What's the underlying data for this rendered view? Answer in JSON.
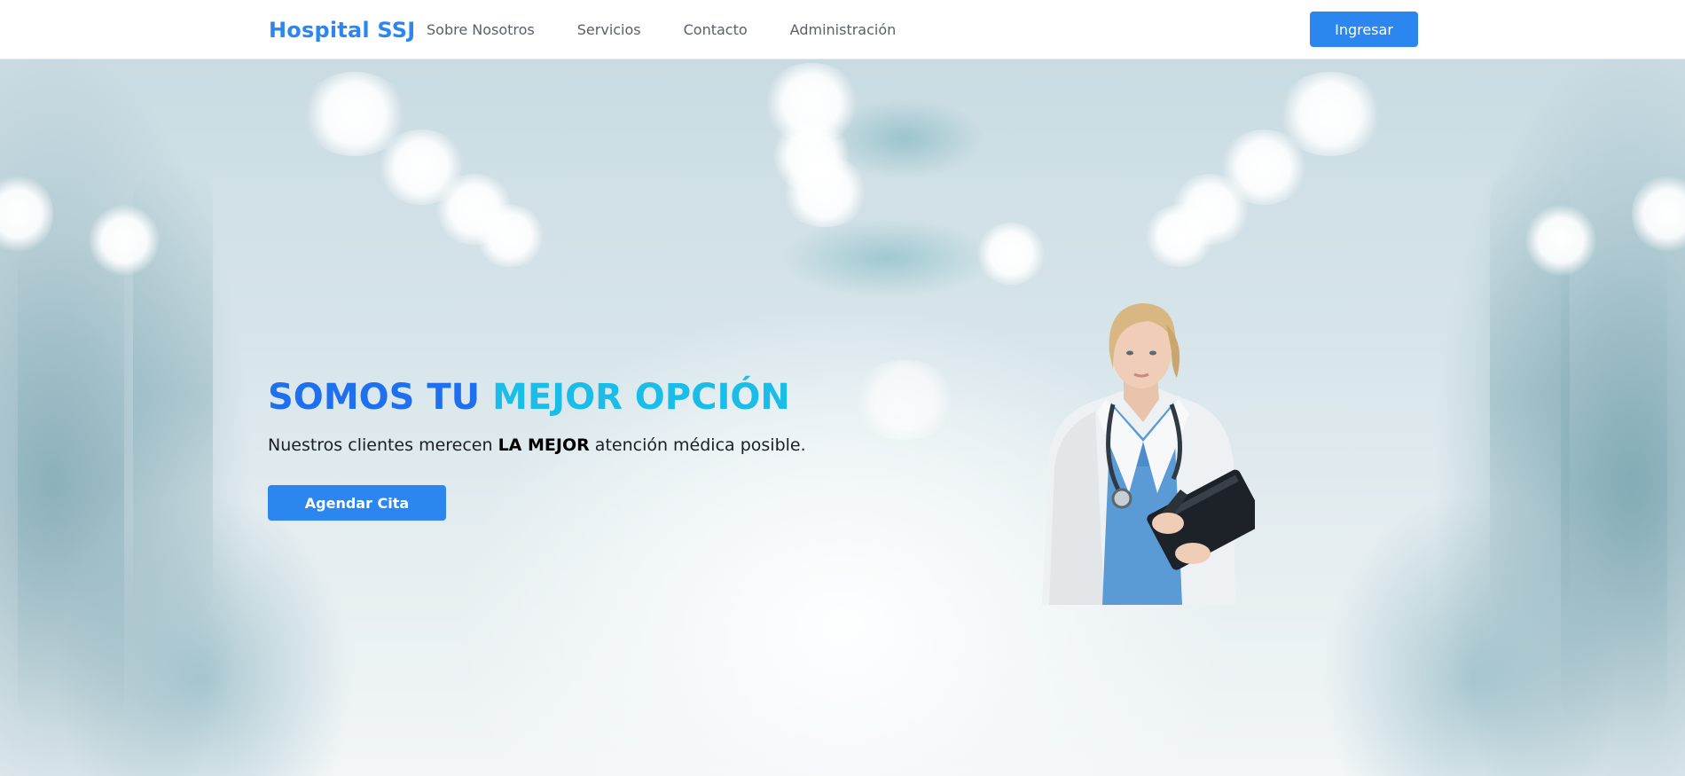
{
  "navbar": {
    "brand": "Hospital SSJ",
    "links": [
      "Sobre Nosotros",
      "Servicios",
      "Contacto",
      "Administración"
    ],
    "login_label": "Ingresar"
  },
  "hero": {
    "title_part1": "SOMOS TU",
    "title_part2": "MEJOR OPCIÓN",
    "subtitle_before": "Nuestros clientes merecen",
    "subtitle_bold": "LA MEJOR",
    "subtitle_after": "atención médica posible.",
    "cta_label": "Agendar Cita"
  },
  "colors": {
    "brand_blue": "#2c86f0",
    "title_blue": "#1f70ee",
    "title_cyan": "#19bde8"
  }
}
